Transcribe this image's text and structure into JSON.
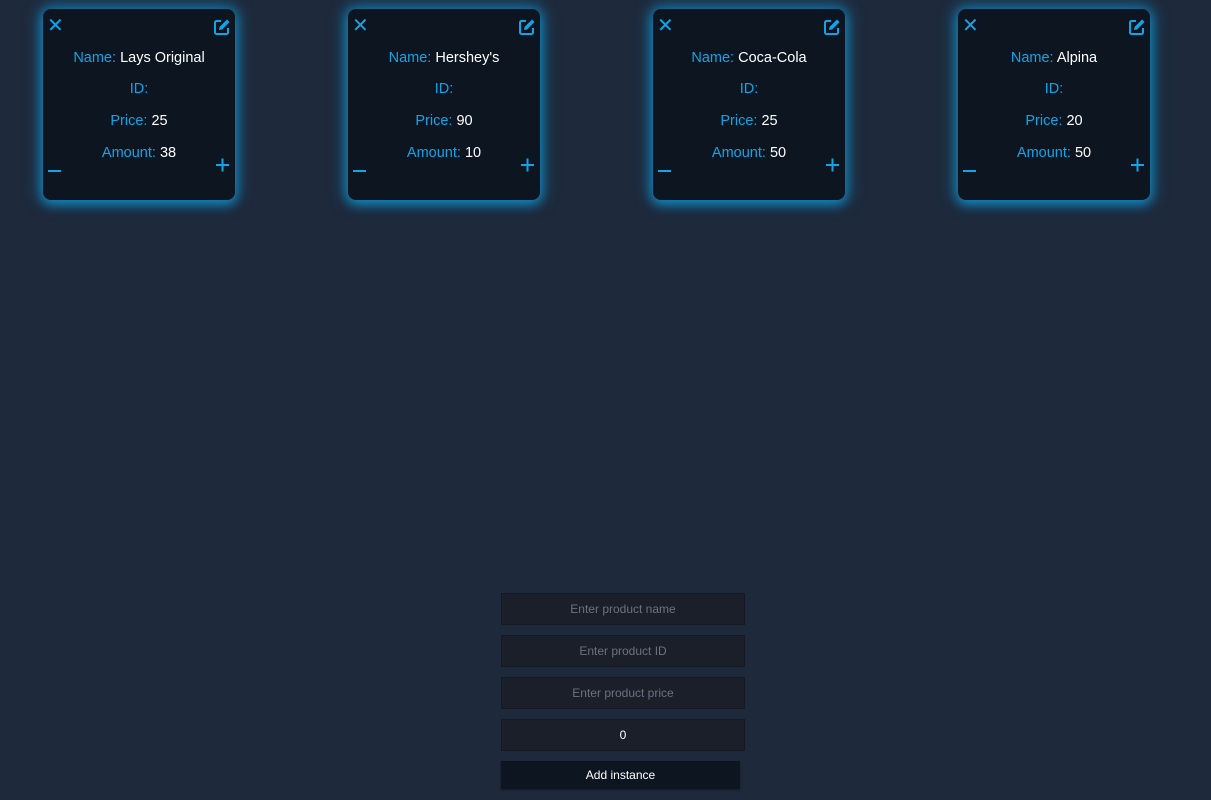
{
  "colors": {
    "background": "#1e293b",
    "card": "#0d1520",
    "accent": "#0ea5e9",
    "text": "#ffffff"
  },
  "labels": {
    "name": "Name:",
    "id": "ID:",
    "price": "Price:",
    "amount": "Amount:"
  },
  "products": [
    {
      "name": "Lays Original",
      "id": "",
      "price": "25",
      "amount": "38"
    },
    {
      "name": "Hershey's",
      "id": "",
      "price": "90",
      "amount": "10"
    },
    {
      "name": "Coca-Cola",
      "id": "",
      "price": "25",
      "amount": "50"
    },
    {
      "name": "Alpina",
      "id": "",
      "price": "20",
      "amount": "50"
    }
  ],
  "icons": {
    "close": "close-icon",
    "edit": "edit-icon",
    "minus": "minus-icon",
    "plus": "plus-icon"
  },
  "form": {
    "name_placeholder": "Enter product name",
    "name_value": "",
    "id_placeholder": "Enter product ID",
    "id_value": "",
    "price_placeholder": "Enter product price",
    "price_value": "",
    "amount_value": "0",
    "submit_label": "Add instance"
  }
}
